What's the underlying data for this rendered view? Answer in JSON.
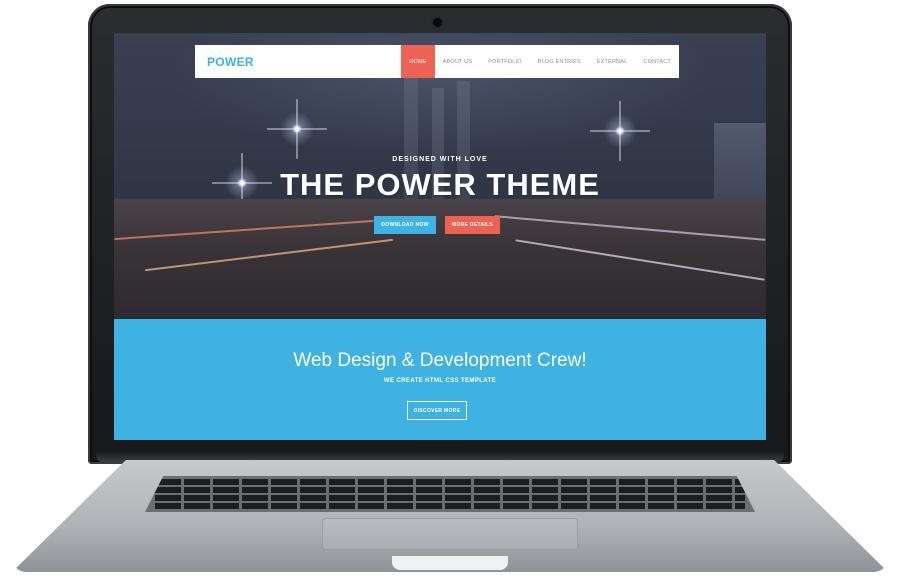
{
  "site": {
    "logo": "POWER",
    "nav": [
      {
        "label": "HOME",
        "active": true
      },
      {
        "label": "ABOUT US",
        "active": false
      },
      {
        "label": "PORTFOLIO",
        "active": false
      },
      {
        "label": "BLOG ENTRIES",
        "active": false
      },
      {
        "label": "EXTERNAL",
        "active": false
      },
      {
        "label": "CONTACT",
        "active": false
      }
    ],
    "hero": {
      "eyebrow": "DESIGNED WITH LOVE",
      "title": "THE POWER THEME",
      "download_label": "DOWNLOAD NOW",
      "details_label": "MORE DETAILS"
    },
    "band": {
      "title": "Web Design & Development Crew!",
      "subtitle": "WE CREATE HTML CSS TEMPLATE",
      "button_label": "DISCOVER MORE"
    }
  },
  "colors": {
    "accent_blue": "#3eb3e3",
    "accent_red": "#ee6155",
    "logo_blue": "#3fb0e3"
  },
  "icons": [
    "camera-icon"
  ]
}
